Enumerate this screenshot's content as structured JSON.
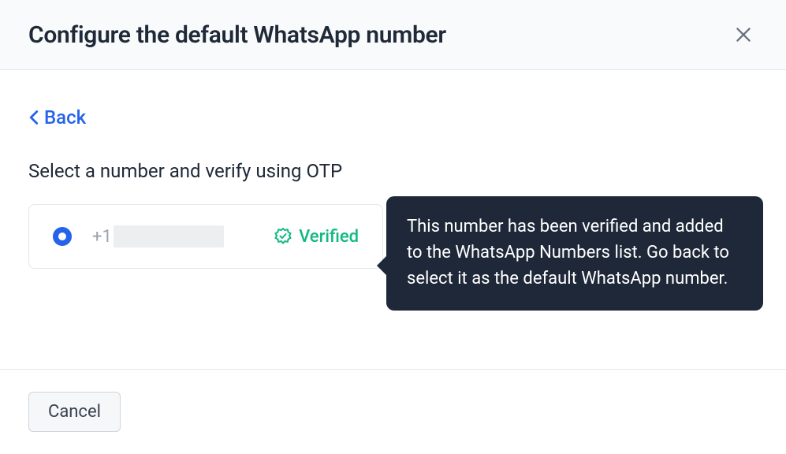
{
  "header": {
    "title": "Configure the default WhatsApp number"
  },
  "body": {
    "back_label": "Back",
    "instruction": "Select a number and verify using OTP",
    "number_prefix": "+1",
    "verified_label": "Verified",
    "tooltip": "This number has been verified and added to the WhatsApp Numbers list. Go back to select it as the default WhatsApp number."
  },
  "footer": {
    "cancel_label": "Cancel"
  },
  "colors": {
    "accent": "#2563eb",
    "success": "#10b981",
    "tooltip_bg": "#1e2838"
  }
}
